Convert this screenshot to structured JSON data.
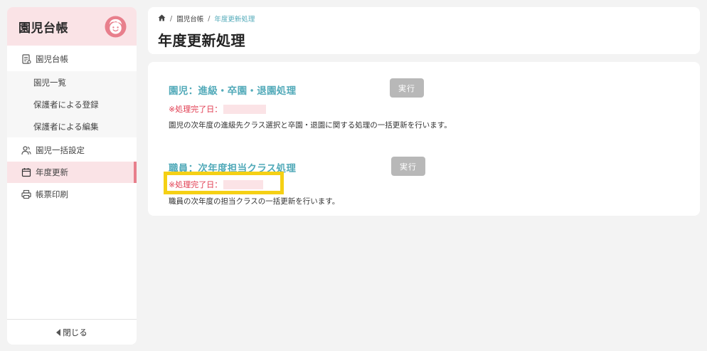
{
  "sidebar": {
    "title": "園児台帳",
    "items": [
      {
        "label": "園児台帳",
        "icon": "ledger-icon"
      },
      {
        "label": "園児一覧"
      },
      {
        "label": "保護者による登録"
      },
      {
        "label": "保護者による編集"
      },
      {
        "label": "園児一括設定",
        "icon": "users-icon"
      },
      {
        "label": "年度更新",
        "icon": "calendar-icon",
        "active": true
      },
      {
        "label": "帳票印刷",
        "icon": "printer-icon"
      }
    ],
    "close_label": "閉じる"
  },
  "breadcrumb": {
    "home_icon": "home-icon",
    "items": [
      "園児台帳",
      "年度更新処理"
    ]
  },
  "page_title": "年度更新処理",
  "sections": [
    {
      "title": "園児：進級・卒園・退園処理",
      "button_label": "実行",
      "done_label": "※処理完了日：",
      "description": "園児の次年度の進級先クラス選択と卒園・退園に関する処理の一括更新を行います。"
    },
    {
      "title": "職員：次年度担当クラス処理",
      "button_label": "実行",
      "done_label": "※処理完了日：",
      "description": "職員の次年度の担当クラスの一括更新を行います。"
    }
  ],
  "colors": {
    "accent": "#52aab9",
    "brand_pink": "#fae3e6",
    "active_bar": "#e87f8c",
    "warning_red": "#e0394e",
    "highlight_yellow": "#f5d015"
  }
}
